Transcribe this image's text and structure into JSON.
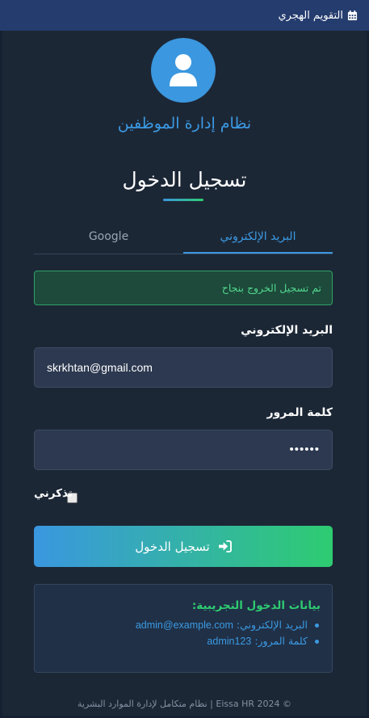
{
  "topbar": {
    "label": "التقويم الهجري",
    "icon": "calendar-icon"
  },
  "header": {
    "avatar_icon": "user-icon",
    "system_name": "نظام إدارة الموظفين",
    "login_title": "تسجيل الدخول"
  },
  "tabs": [
    {
      "label": "البريد الإلكتروني",
      "active": true
    },
    {
      "label": "Google",
      "active": false
    }
  ],
  "alert": {
    "message": "تم تسجيل الخروج بنجاح"
  },
  "form": {
    "email_label": "البريد الإلكتروني",
    "email_value": "skrkhtan@gmail.com",
    "password_label": "كلمة المرور",
    "password_value": "••••••",
    "remember_label": "تذكرني",
    "remember_checked": false,
    "submit_label": "تسجيل الدخول",
    "submit_icon": "sign-in-icon"
  },
  "demo": {
    "title": "بيانات الدخول التجريبية:",
    "email_label": "البريد الإلكتروني:",
    "email_value": "admin@example.com",
    "password_label": "كلمة المرور:",
    "password_value": "admin123"
  },
  "footer": {
    "text": "© 2024 Eissa HR | نظام متكامل لإدارة الموارد البشرية"
  },
  "colors": {
    "background": "#1c2736",
    "topbar": "#243c6e",
    "accent_blue": "#3b97df",
    "accent_green": "#2ecc71",
    "success_bg": "#1d4a3a"
  }
}
